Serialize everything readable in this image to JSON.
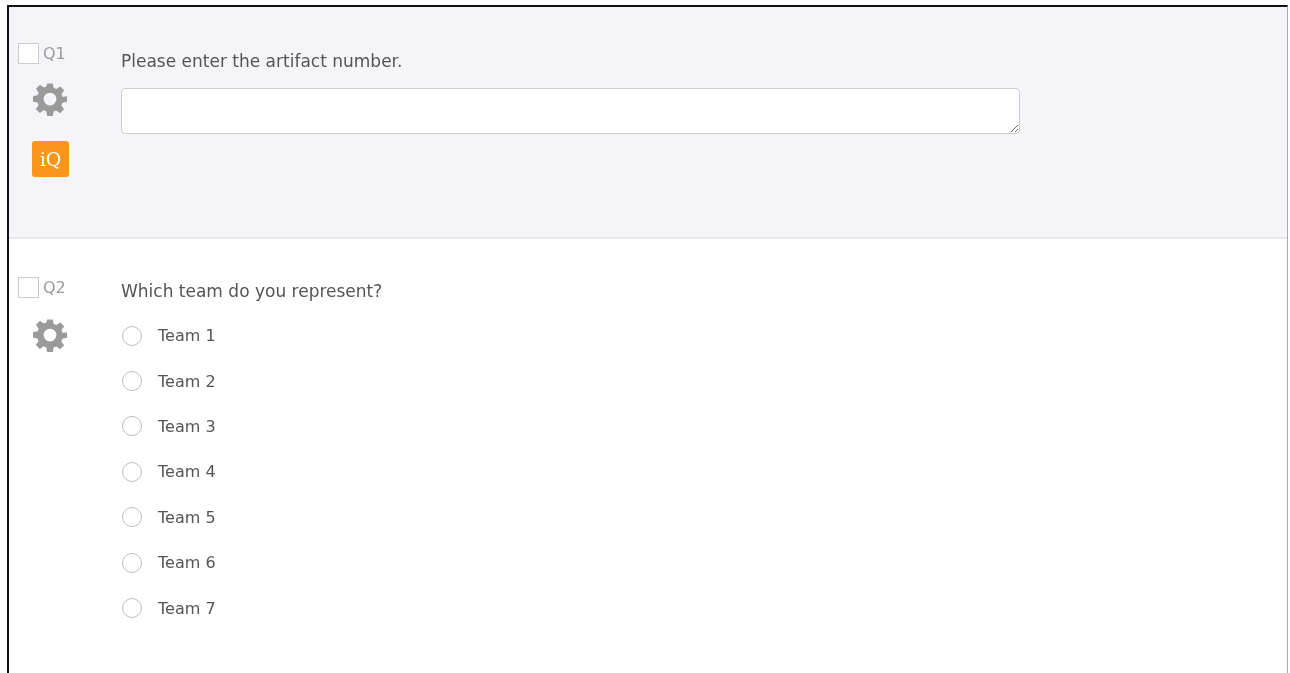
{
  "questions": [
    {
      "number": "Q1",
      "checked": false,
      "kind": "text_entry",
      "text": "Please enter the artifact number.",
      "badge": "iQ",
      "shaded": true
    },
    {
      "number": "Q2",
      "checked": false,
      "kind": "multiple_choice",
      "text": "Which team do you represent?",
      "shaded": false,
      "options": [
        {
          "label": "Team 1",
          "selected": false
        },
        {
          "label": "Team 2",
          "selected": false
        },
        {
          "label": "Team 3",
          "selected": false
        },
        {
          "label": "Team 4",
          "selected": false
        },
        {
          "label": "Team 5",
          "selected": false
        },
        {
          "label": "Team 6",
          "selected": false
        },
        {
          "label": "Team 7",
          "selected": false
        }
      ]
    }
  ]
}
